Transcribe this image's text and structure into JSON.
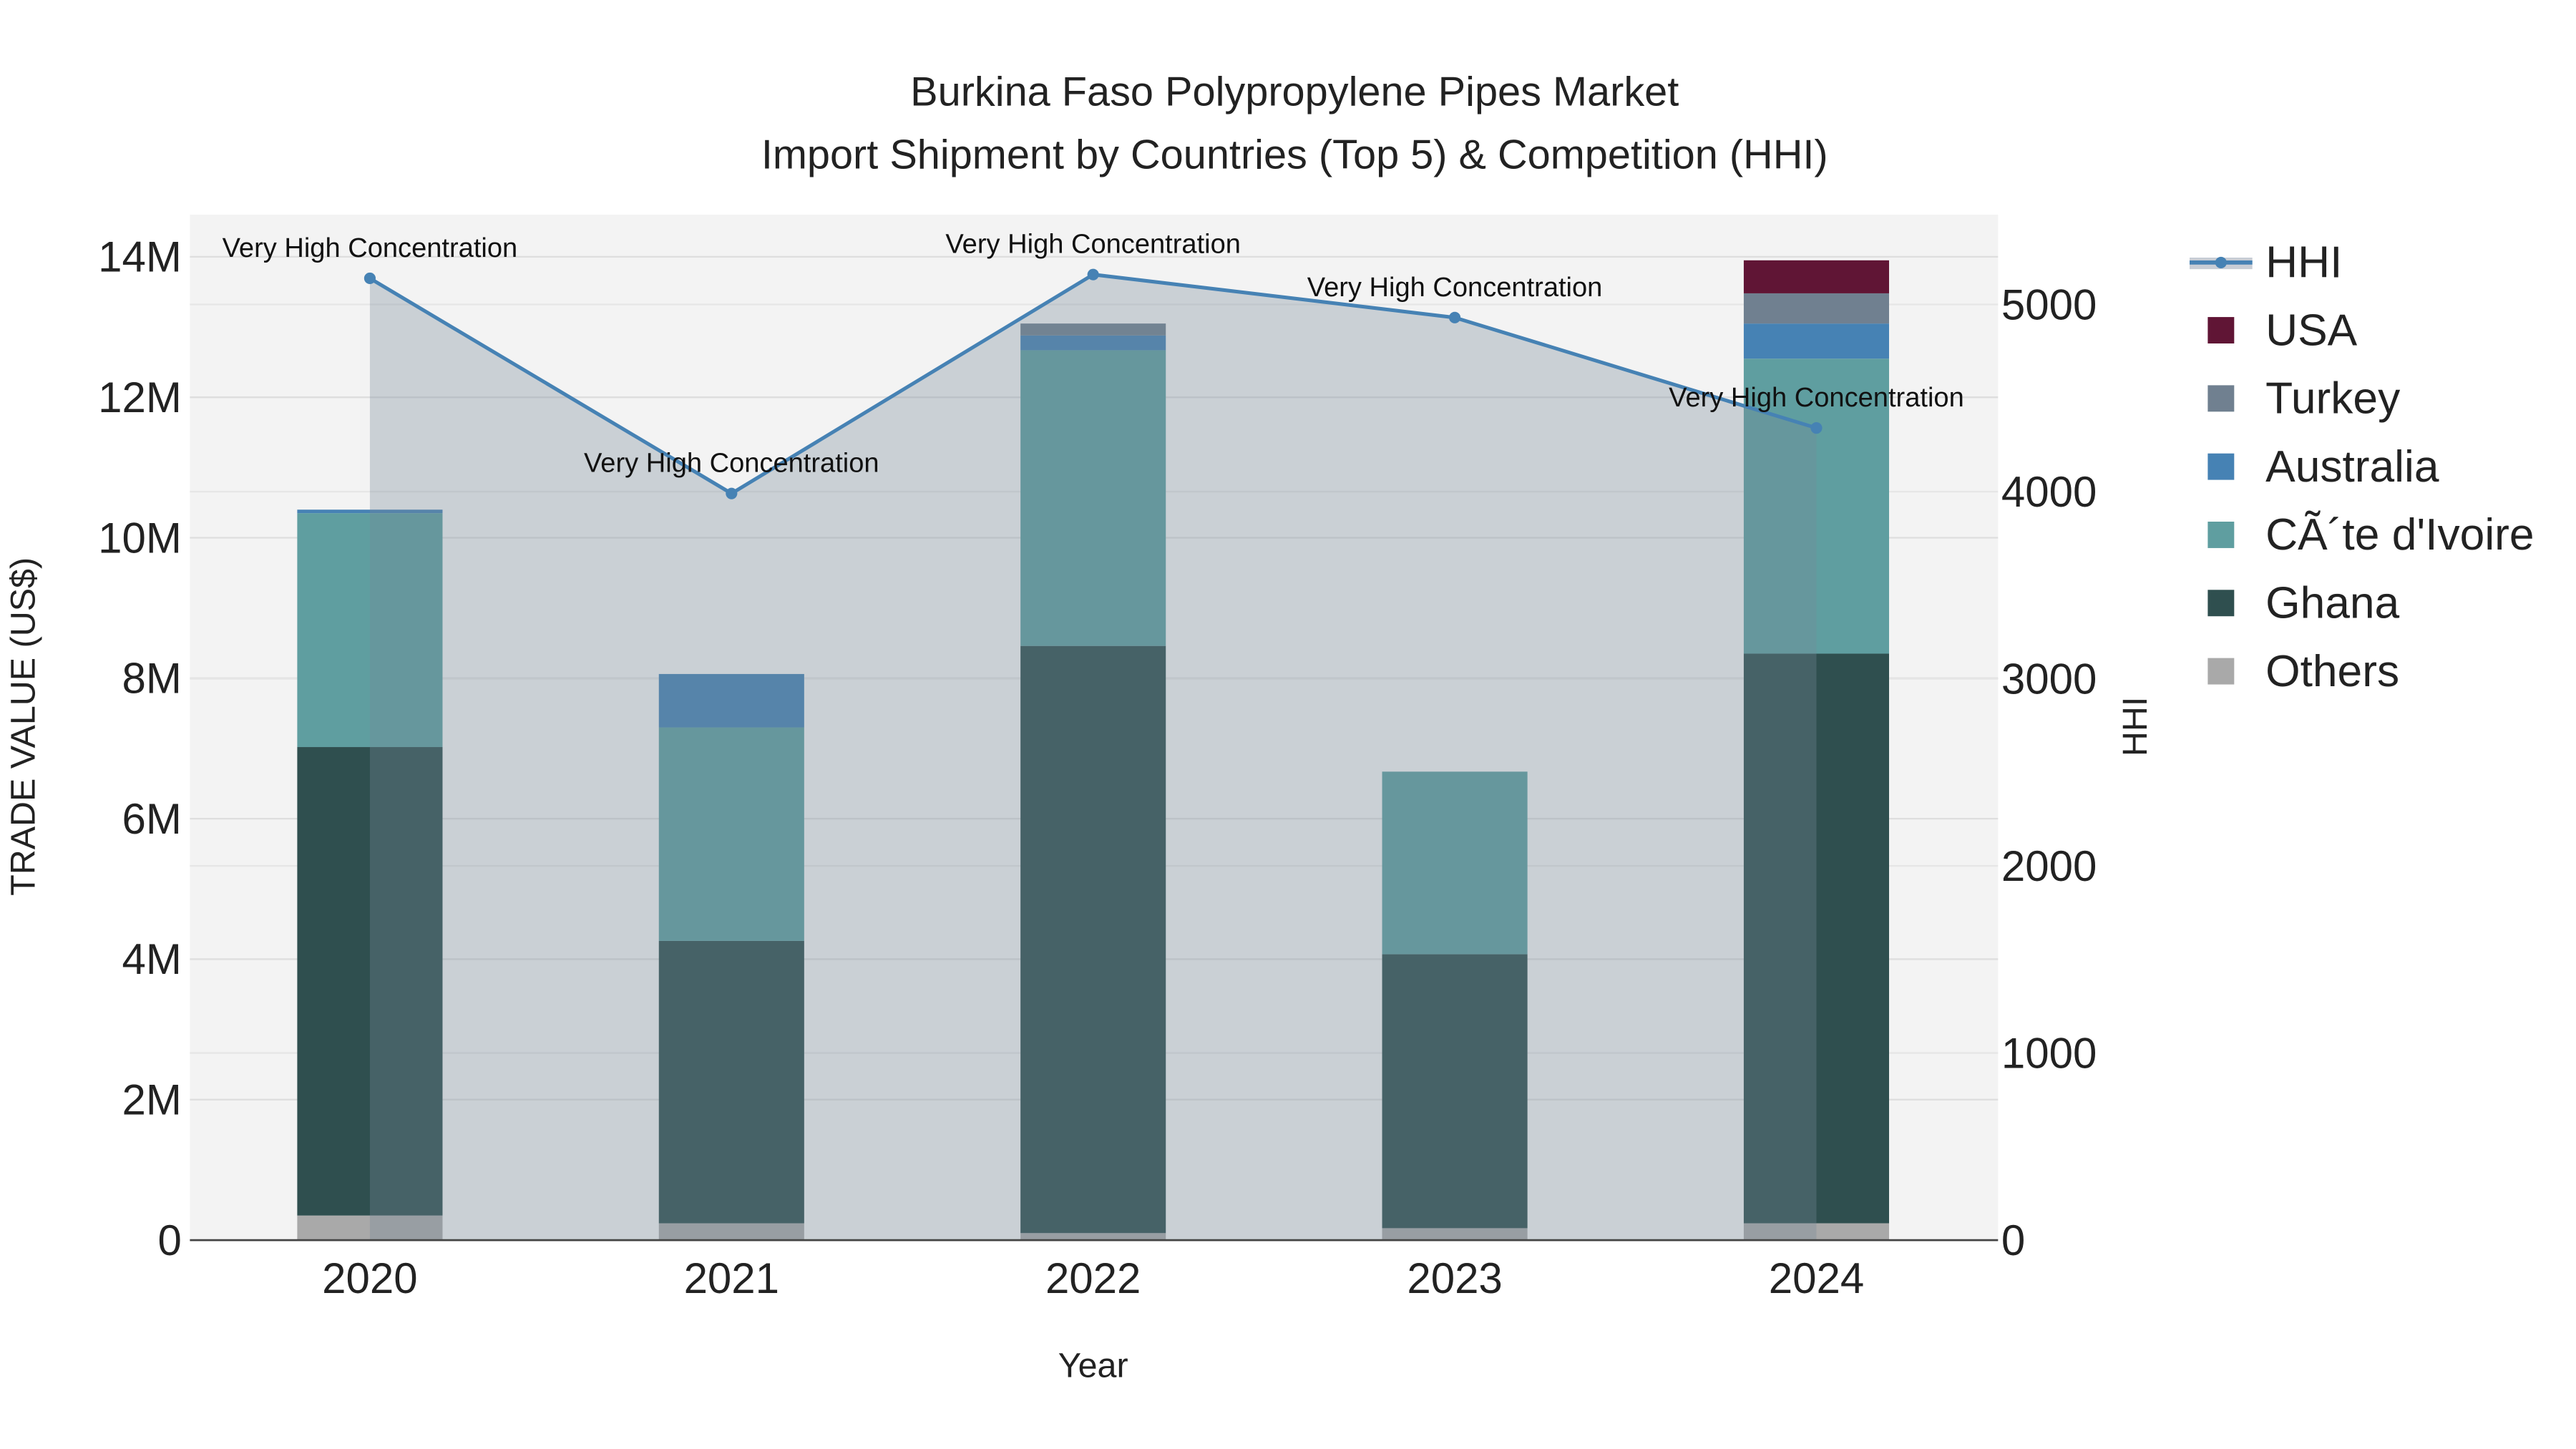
{
  "chart_data": {
    "type": "bar",
    "title": "Burkina Faso Polypropylene Pipes Market",
    "subtitle": "Import Shipment by Countries (Top 5) & Competition (HHI)",
    "xlabel": "Year",
    "ylabel": "TRADE VALUE (US$)",
    "y2label": "HHI",
    "categories": [
      "2020",
      "2021",
      "2022",
      "2023",
      "2024"
    ],
    "ylim": [
      0,
      14600000
    ],
    "y2lim": [
      0,
      5480
    ],
    "yticks": [
      0,
      2000000,
      4000000,
      6000000,
      8000000,
      10000000,
      12000000,
      14000000
    ],
    "ytick_labels": [
      "0",
      "2M",
      "4M",
      "6M",
      "8M",
      "10M",
      "12M",
      "14M"
    ],
    "y2ticks": [
      0,
      1000,
      2000,
      3000,
      4000,
      5000
    ],
    "y2tick_labels": [
      "0",
      "1000",
      "2000",
      "3000",
      "4000",
      "5000"
    ],
    "stacked": true,
    "series": [
      {
        "name": "Others",
        "color": "#a9a9a9",
        "values": [
          350000,
          240000,
          100000,
          170000,
          240000
        ]
      },
      {
        "name": "Ghana",
        "color": "#2f4f4f",
        "values": [
          6670000,
          4020000,
          8360000,
          3900000,
          8110000
        ]
      },
      {
        "name": "CÃ´te d'Ivoire",
        "color": "#5f9ea0",
        "values": [
          3330000,
          3040000,
          4210000,
          2600000,
          4200000
        ]
      },
      {
        "name": "Australia",
        "color": "#4682b4",
        "values": [
          50000,
          760000,
          210000,
          0,
          500000
        ]
      },
      {
        "name": "Turkey",
        "color": "#708090",
        "values": [
          0,
          0,
          170000,
          0,
          430000
        ]
      },
      {
        "name": "USA",
        "color": "#601535",
        "values": [
          0,
          0,
          0,
          0,
          470000
        ]
      }
    ],
    "hhi": {
      "name": "HHI",
      "color": "#4682b4",
      "fill": "rgba(119,136,153,0.33)",
      "values": [
        5140,
        3990,
        5160,
        4930,
        4340
      ],
      "annotations": [
        "Very High Concentration",
        "Very High Concentration",
        "Very High Concentration",
        "Very High Concentration",
        "Very High Concentration"
      ]
    },
    "legend_placement": "right",
    "legend_order": [
      "HHI",
      "USA",
      "Turkey",
      "Australia",
      "CÃ´te d'Ivoire",
      "Ghana",
      "Others"
    ],
    "grid": true
  }
}
